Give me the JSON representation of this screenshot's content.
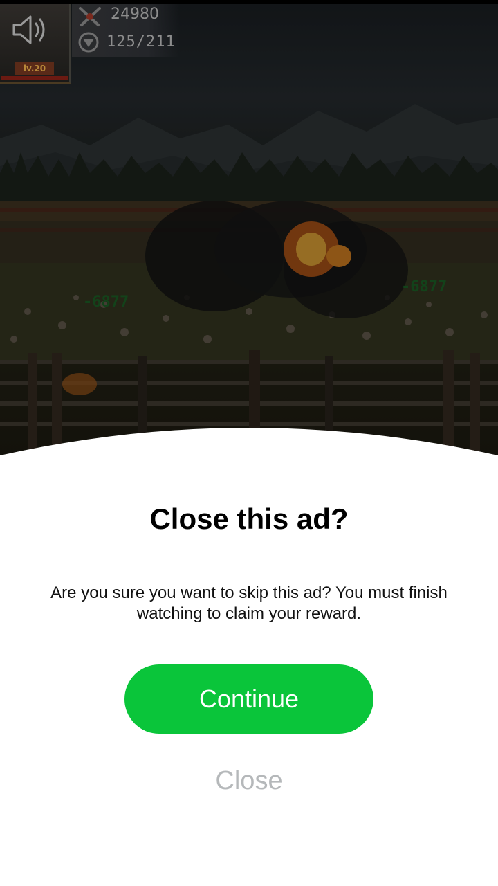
{
  "game_hud": {
    "level": "lv.20",
    "score": "24980",
    "troops": "125/211",
    "damage_left": "-6877",
    "damage_right": "-6877",
    "icons": [
      "sound-icon",
      "swords-icon",
      "rank-badge-icon"
    ]
  },
  "dialog": {
    "title": "Close this ad?",
    "message": "Are you sure you want to skip this ad? You must finish watching to claim your reward.",
    "continue_label": "Continue",
    "close_label": "Close"
  },
  "colors": {
    "continue_button": "#0AC53A",
    "close_text": "#B5B8BA",
    "sheet_background": "#FFFFFF"
  }
}
